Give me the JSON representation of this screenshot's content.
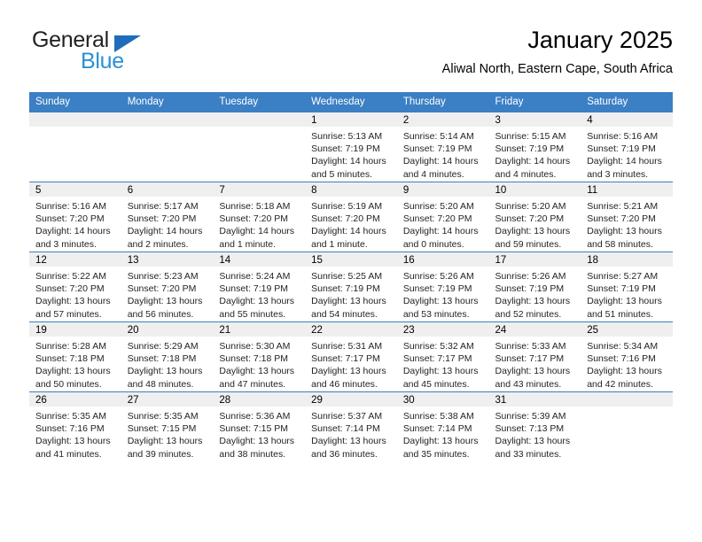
{
  "brand": {
    "name_part1": "General",
    "name_part2": "Blue",
    "colors": {
      "dark": "#231f20",
      "blue": "#2b8fd6",
      "triangle": "#1f6dba"
    }
  },
  "header": {
    "title": "January 2025",
    "subtitle": "Aliwal North, Eastern Cape, South Africa"
  },
  "theme": {
    "header_bg": "#3b7fc4",
    "header_text": "#ffffff",
    "daynum_band_bg": "#efeff0",
    "cell_bg": "#ffffff",
    "row_divider": "#3b7fc4"
  },
  "weekday_headers": [
    "Sunday",
    "Monday",
    "Tuesday",
    "Wednesday",
    "Thursday",
    "Friday",
    "Saturday"
  ],
  "weeks": [
    [
      {
        "day": "",
        "lines": []
      },
      {
        "day": "",
        "lines": []
      },
      {
        "day": "",
        "lines": []
      },
      {
        "day": "1",
        "lines": [
          "Sunrise: 5:13 AM",
          "Sunset: 7:19 PM",
          "Daylight: 14 hours",
          "and 5 minutes."
        ]
      },
      {
        "day": "2",
        "lines": [
          "Sunrise: 5:14 AM",
          "Sunset: 7:19 PM",
          "Daylight: 14 hours",
          "and 4 minutes."
        ]
      },
      {
        "day": "3",
        "lines": [
          "Sunrise: 5:15 AM",
          "Sunset: 7:19 PM",
          "Daylight: 14 hours",
          "and 4 minutes."
        ]
      },
      {
        "day": "4",
        "lines": [
          "Sunrise: 5:16 AM",
          "Sunset: 7:19 PM",
          "Daylight: 14 hours",
          "and 3 minutes."
        ]
      }
    ],
    [
      {
        "day": "5",
        "lines": [
          "Sunrise: 5:16 AM",
          "Sunset: 7:20 PM",
          "Daylight: 14 hours",
          "and 3 minutes."
        ]
      },
      {
        "day": "6",
        "lines": [
          "Sunrise: 5:17 AM",
          "Sunset: 7:20 PM",
          "Daylight: 14 hours",
          "and 2 minutes."
        ]
      },
      {
        "day": "7",
        "lines": [
          "Sunrise: 5:18 AM",
          "Sunset: 7:20 PM",
          "Daylight: 14 hours",
          "and 1 minute."
        ]
      },
      {
        "day": "8",
        "lines": [
          "Sunrise: 5:19 AM",
          "Sunset: 7:20 PM",
          "Daylight: 14 hours",
          "and 1 minute."
        ]
      },
      {
        "day": "9",
        "lines": [
          "Sunrise: 5:20 AM",
          "Sunset: 7:20 PM",
          "Daylight: 14 hours",
          "and 0 minutes."
        ]
      },
      {
        "day": "10",
        "lines": [
          "Sunrise: 5:20 AM",
          "Sunset: 7:20 PM",
          "Daylight: 13 hours",
          "and 59 minutes."
        ]
      },
      {
        "day": "11",
        "lines": [
          "Sunrise: 5:21 AM",
          "Sunset: 7:20 PM",
          "Daylight: 13 hours",
          "and 58 minutes."
        ]
      }
    ],
    [
      {
        "day": "12",
        "lines": [
          "Sunrise: 5:22 AM",
          "Sunset: 7:20 PM",
          "Daylight: 13 hours",
          "and 57 minutes."
        ]
      },
      {
        "day": "13",
        "lines": [
          "Sunrise: 5:23 AM",
          "Sunset: 7:20 PM",
          "Daylight: 13 hours",
          "and 56 minutes."
        ]
      },
      {
        "day": "14",
        "lines": [
          "Sunrise: 5:24 AM",
          "Sunset: 7:19 PM",
          "Daylight: 13 hours",
          "and 55 minutes."
        ]
      },
      {
        "day": "15",
        "lines": [
          "Sunrise: 5:25 AM",
          "Sunset: 7:19 PM",
          "Daylight: 13 hours",
          "and 54 minutes."
        ]
      },
      {
        "day": "16",
        "lines": [
          "Sunrise: 5:26 AM",
          "Sunset: 7:19 PM",
          "Daylight: 13 hours",
          "and 53 minutes."
        ]
      },
      {
        "day": "17",
        "lines": [
          "Sunrise: 5:26 AM",
          "Sunset: 7:19 PM",
          "Daylight: 13 hours",
          "and 52 minutes."
        ]
      },
      {
        "day": "18",
        "lines": [
          "Sunrise: 5:27 AM",
          "Sunset: 7:19 PM",
          "Daylight: 13 hours",
          "and 51 minutes."
        ]
      }
    ],
    [
      {
        "day": "19",
        "lines": [
          "Sunrise: 5:28 AM",
          "Sunset: 7:18 PM",
          "Daylight: 13 hours",
          "and 50 minutes."
        ]
      },
      {
        "day": "20",
        "lines": [
          "Sunrise: 5:29 AM",
          "Sunset: 7:18 PM",
          "Daylight: 13 hours",
          "and 48 minutes."
        ]
      },
      {
        "day": "21",
        "lines": [
          "Sunrise: 5:30 AM",
          "Sunset: 7:18 PM",
          "Daylight: 13 hours",
          "and 47 minutes."
        ]
      },
      {
        "day": "22",
        "lines": [
          "Sunrise: 5:31 AM",
          "Sunset: 7:17 PM",
          "Daylight: 13 hours",
          "and 46 minutes."
        ]
      },
      {
        "day": "23",
        "lines": [
          "Sunrise: 5:32 AM",
          "Sunset: 7:17 PM",
          "Daylight: 13 hours",
          "and 45 minutes."
        ]
      },
      {
        "day": "24",
        "lines": [
          "Sunrise: 5:33 AM",
          "Sunset: 7:17 PM",
          "Daylight: 13 hours",
          "and 43 minutes."
        ]
      },
      {
        "day": "25",
        "lines": [
          "Sunrise: 5:34 AM",
          "Sunset: 7:16 PM",
          "Daylight: 13 hours",
          "and 42 minutes."
        ]
      }
    ],
    [
      {
        "day": "26",
        "lines": [
          "Sunrise: 5:35 AM",
          "Sunset: 7:16 PM",
          "Daylight: 13 hours",
          "and 41 minutes."
        ]
      },
      {
        "day": "27",
        "lines": [
          "Sunrise: 5:35 AM",
          "Sunset: 7:15 PM",
          "Daylight: 13 hours",
          "and 39 minutes."
        ]
      },
      {
        "day": "28",
        "lines": [
          "Sunrise: 5:36 AM",
          "Sunset: 7:15 PM",
          "Daylight: 13 hours",
          "and 38 minutes."
        ]
      },
      {
        "day": "29",
        "lines": [
          "Sunrise: 5:37 AM",
          "Sunset: 7:14 PM",
          "Daylight: 13 hours",
          "and 36 minutes."
        ]
      },
      {
        "day": "30",
        "lines": [
          "Sunrise: 5:38 AM",
          "Sunset: 7:14 PM",
          "Daylight: 13 hours",
          "and 35 minutes."
        ]
      },
      {
        "day": "31",
        "lines": [
          "Sunrise: 5:39 AM",
          "Sunset: 7:13 PM",
          "Daylight: 13 hours",
          "and 33 minutes."
        ]
      },
      {
        "day": "",
        "lines": []
      }
    ]
  ]
}
